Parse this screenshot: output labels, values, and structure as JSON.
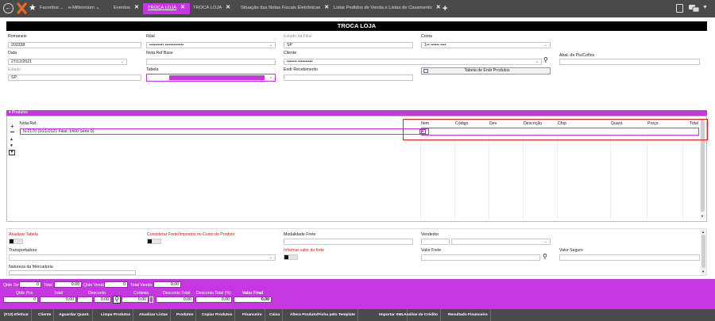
{
  "topbar": {
    "favoritos": "Favoritos",
    "tabs": [
      {
        "label": "e-Millennium",
        "suffix": "⌄"
      },
      {
        "label": "Eventos"
      },
      {
        "label": "TROCA LOJA"
      },
      {
        "label": "TROCA LOJA"
      },
      {
        "label": "Situação das Notas Fiscais Eletrônicas"
      },
      {
        "label": "Listar Pedidos de Venda e Listas de Casamento"
      }
    ],
    "add": "+"
  },
  "title": "TROCA LOJA",
  "form": {
    "romaneio_label": "Romaneio",
    "romaneio_value": "202338",
    "filial_label": "Filial",
    "filial_value": "•••••••••• •••••••••••••",
    "estado_filial_label": "Estado da Filial",
    "estado_filial_value": "SP",
    "conta_label": "Conta",
    "conta_value": "1••  •••••• ••••",
    "data_label": "Data",
    "data_value": "27/12/2021",
    "nota_ref_base_label": "Nota Ref Base",
    "cliente_label": "Cliente",
    "cliente_value": "•••••••  ••••••••••",
    "abat_label": "Abat. de Pis/Cofins",
    "estado_label": "Estado",
    "estado_value": "SP",
    "tabela_label": "Tabela",
    "endr_label": "Endr Recebimento",
    "tabela_endr_button": "Tabela de Endr Produtos"
  },
  "produtos": {
    "header": "Produtos",
    "nota_ref_label": "Nota Ref.",
    "nota_ref_value": "N-2170 (16/1/2021 Filial: 1400 Série:0)",
    "columns": [
      "Item",
      "Código",
      "Dev.",
      "Descrição",
      "Cfop",
      "Quant.",
      "Preço",
      "Total"
    ]
  },
  "options": {
    "atualizar_tabela": "Atualizar Tabela",
    "considerar_frete": "Considerar Frete/Impostos no Custo do Produto",
    "modalidade_frete": "Modalidade Frete",
    "vendedor": "Vendedor",
    "transportadora": "Transportadora",
    "informar_valor_frete": "Informar valor do frete",
    "valor_frete": "Valor Frete",
    "valor_seguro": "Valor Seguro",
    "natureza": "Natureza da Mercadoria"
  },
  "footer": {
    "qtde_dev_label": "Qtde Dev.",
    "qtde_dev_value": "0",
    "total_label": "Total",
    "total_value": "0,00",
    "qtde_venda_label": "Qtde Venda",
    "qtde_venda_value": "0",
    "total_venda_label": "Total Venda",
    "total_venda_value": "0,00",
    "qtde_pcs_label": "Qtde Pcs",
    "qtde_pcs_value": "0",
    "total2_label": "Total",
    "total2_value": "0,00",
    "desconto_label": "Desconto",
    "desconto_value": "0,00",
    "cortesia_label": "Cortesia",
    "cortesia_value": "0,00",
    "desconto_total_label": "Desconto Total",
    "desconto_total_value": "0,00",
    "desconto_total_pct_label": "Desconto Total (%)",
    "desconto_total_pct_value": "0,00",
    "valor_final_label": "Valor Final",
    "valor_final_value": "0,00"
  },
  "actions": [
    "(F12) Efetivar",
    "Cliente",
    "Aguardar Quant.",
    "Limpa Produtos",
    "Atualizar Listas",
    "Produtos",
    "Copiar Produtos",
    "Financeiro",
    "Caixa",
    "Altera Produto/Ficha pelo Template",
    "Importar XML",
    "Análise de Crédito",
    "Resultado Financeiro"
  ],
  "colors": {
    "accent": "#c537e0",
    "topbar": "#4a4a4a",
    "highlight": "#e02020"
  }
}
